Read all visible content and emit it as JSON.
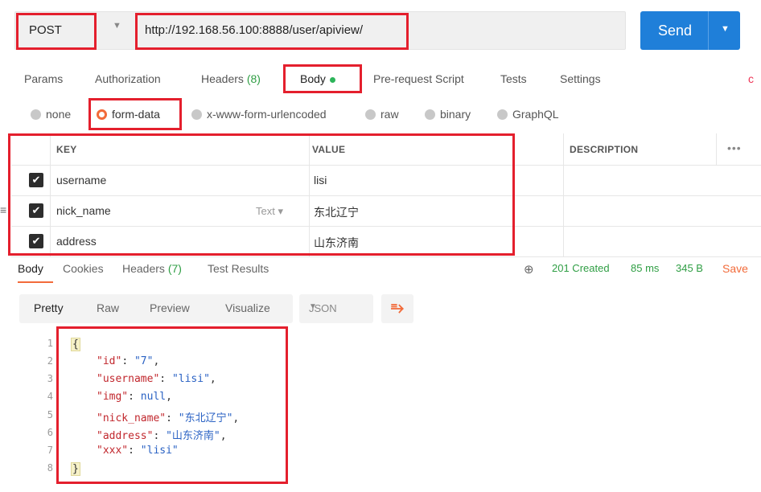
{
  "request": {
    "method": "POST",
    "url": "http://192.168.56.100:8888/user/apiview/",
    "send_label": "Send"
  },
  "tabs": {
    "params": "Params",
    "authorization": "Authorization",
    "headers": "Headers",
    "headers_count": "(8)",
    "body": "Body",
    "pre_request": "Pre-request Script",
    "tests": "Tests",
    "settings": "Settings",
    "edge_letter": "c"
  },
  "body_types": {
    "none": "none",
    "form_data": "form-data",
    "urlencoded": "x-www-form-urlencoded",
    "raw": "raw",
    "binary": "binary",
    "graphql": "GraphQL",
    "selected": "form-data"
  },
  "params_table": {
    "headers": {
      "key": "KEY",
      "value": "VALUE",
      "description": "DESCRIPTION"
    },
    "rows": [
      {
        "key": "username",
        "value": "lisi",
        "type": ""
      },
      {
        "key": "nick_name",
        "value": "东北辽宁",
        "type": "Text ▾"
      },
      {
        "key": "address",
        "value": "山东济南",
        "type": ""
      }
    ]
  },
  "response": {
    "tabs": {
      "body": "Body",
      "cookies": "Cookies",
      "headers": "Headers",
      "headers_count": "(7)",
      "test_results": "Test Results"
    },
    "status": "201 Created",
    "time": "85 ms",
    "size": "345 B",
    "save": "Save"
  },
  "view": {
    "pretty": "Pretty",
    "raw": "Raw",
    "preview": "Preview",
    "visualize": "Visualize",
    "format": "JSON"
  },
  "code_lines": {
    "l1": "{",
    "l2_key": "\"id\"",
    "l2_val": "\"7\"",
    "l3_key": "\"username\"",
    "l3_val": "\"lisi\"",
    "l4_key": "\"img\"",
    "l4_val": "null",
    "l5_key": "\"nick_name\"",
    "l5_val": "\"东北辽宁\"",
    "l6_key": "\"address\"",
    "l6_val": "\"山东济南\"",
    "l7_key": "\"xxx\"",
    "l7_val": "\"lisi\"",
    "l8": "}"
  },
  "line_numbers": [
    "1",
    "2",
    "3",
    "4",
    "5",
    "6",
    "7",
    "8"
  ],
  "colors": {
    "send": "#1f7fd9",
    "accent": "#f26b3a",
    "success": "#2f9e44",
    "highlight": "#e41f2d"
  }
}
